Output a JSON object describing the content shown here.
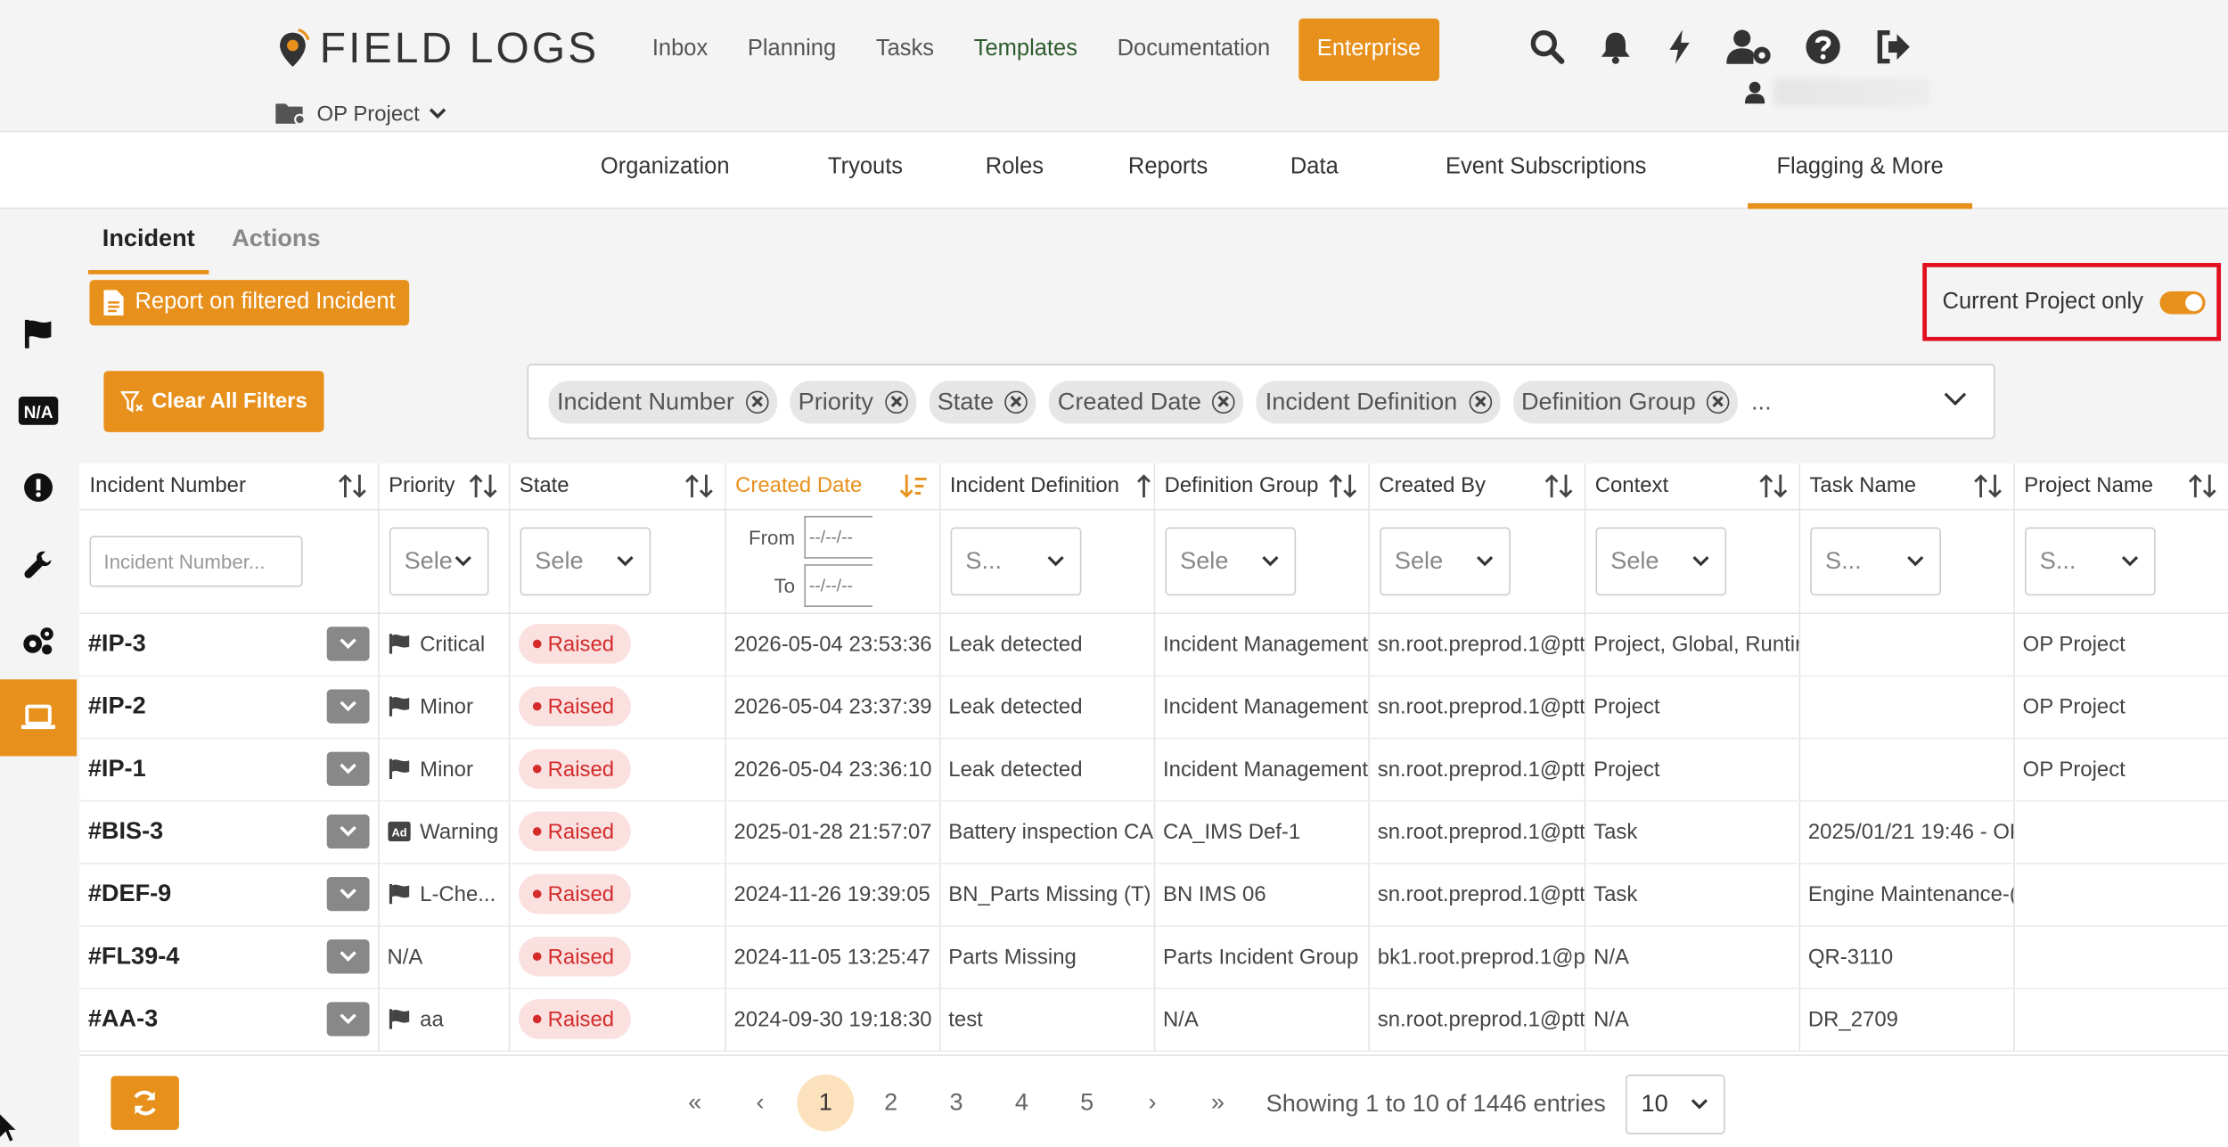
{
  "app": {
    "logo_text": "FIELD LOGS",
    "project": "OP Project"
  },
  "main_nav": [
    "Inbox",
    "Planning",
    "Tasks",
    "Templates",
    "Documentation"
  ],
  "enterprise_label": "Enterprise",
  "sub_nav": [
    "Organization",
    "Tryouts",
    "Roles",
    "Reports",
    "Data",
    "Event Subscriptions",
    "Flagging & More"
  ],
  "content_tabs": [
    "Incident",
    "Actions"
  ],
  "report_button": "Report on filtered Incident",
  "toggle_label": "Current Project only",
  "clear_filters": "Clear All Filters",
  "filter_chips": [
    "Incident Number",
    "Priority",
    "State",
    "Created Date",
    "Incident Definition",
    "Definition Group"
  ],
  "chips_more": "...",
  "columns": [
    "Incident Number",
    "Priority",
    "State",
    "Created Date",
    "Incident Definition",
    "Definition Group",
    "Created By",
    "Context",
    "Task Name",
    "Project Name"
  ],
  "filters": {
    "incident_placeholder": "Incident Number...",
    "priority": "Sele",
    "state": "Sele",
    "date_from": "From",
    "date_to": "To",
    "date_placeholder": "--/--/--",
    "definition": "S...",
    "group": "Sele",
    "created_by": "Sele",
    "context": "Sele",
    "task": "S...",
    "project": "S..."
  },
  "rows": [
    {
      "id": "#IP-3",
      "priority": "Critical",
      "state": "Raised",
      "created": "2026-05-04 23:53:36",
      "definition": "Leak detected",
      "group": "Incident Management",
      "by": "sn.root.preprod.1@ptt.",
      "context": "Project, Global, Runtin",
      "task": "",
      "project": "OP Project"
    },
    {
      "id": "#IP-2",
      "priority": "Minor",
      "state": "Raised",
      "created": "2026-05-04 23:37:39",
      "definition": "Leak detected",
      "group": "Incident Management",
      "by": "sn.root.preprod.1@ptt.",
      "context": "Project",
      "task": "",
      "project": "OP Project"
    },
    {
      "id": "#IP-1",
      "priority": "Minor",
      "state": "Raised",
      "created": "2026-05-04 23:36:10",
      "definition": "Leak detected",
      "group": "Incident Management",
      "by": "sn.root.preprod.1@ptt.",
      "context": "Project",
      "task": "",
      "project": "OP Project"
    },
    {
      "id": "#BIS-3",
      "priority": "Warning",
      "state": "Raised",
      "created": "2025-01-28 21:57:07",
      "definition": "Battery inspection CA",
      "group": "CA_IMS Def-1",
      "by": "sn.root.preprod.1@ptt.",
      "context": "Task",
      "task": "2025/01/21 19:46 - OP",
      "project": ""
    },
    {
      "id": "#DEF-9",
      "priority": "L-Che...",
      "state": "Raised",
      "created": "2024-11-26 19:39:05",
      "definition": "BN_Parts Missing (T)",
      "group": "BN IMS 06",
      "by": "sn.root.preprod.1@ptt.",
      "context": "Task",
      "task": "Engine Maintenance-(",
      "project": ""
    },
    {
      "id": "#FL39-4",
      "priority": "N/A",
      "state": "Raised",
      "created": "2024-11-05 13:25:47",
      "definition": "Parts Missing",
      "group": "Parts Incident Group",
      "by": "bk1.root.preprod.1@ptt",
      "context": "N/A",
      "task": "QR-3110",
      "project": ""
    },
    {
      "id": "#AA-3",
      "priority": "aa",
      "state": "Raised",
      "created": "2024-09-30 19:18:30",
      "definition": "test",
      "group": "N/A",
      "by": "sn.root.preprod.1@ptt.",
      "context": "N/A",
      "task": "DR_2709",
      "project": ""
    }
  ],
  "pagination": {
    "pages": [
      "1",
      "2",
      "3",
      "4",
      "5"
    ],
    "current": "1",
    "first": "«",
    "prev": "‹",
    "next": "›",
    "last": "»",
    "entries": "Showing 1 to 10 of 1446 entries",
    "page_size": "10"
  },
  "colors": {
    "accent": "#e8901c",
    "raised_text": "#d42b2b",
    "raised_bg": "#fbe0e0",
    "highlight_border": "#e01020"
  },
  "icons": {
    "priority_flag": "flag-icon",
    "warning": "ad-icon"
  }
}
